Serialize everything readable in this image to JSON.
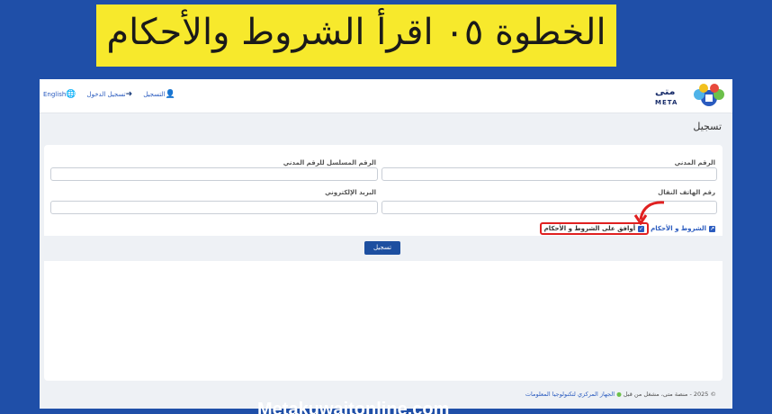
{
  "banner": {
    "text": "الخطوة ٠٥   اقرأ الشروط والأحكام"
  },
  "topbar": {
    "english": "English",
    "login": "تسجيل الدخول",
    "register": "التسجيل",
    "logo_text": "متى",
    "logo_sub": "META"
  },
  "page": {
    "title": "تسجيل"
  },
  "form": {
    "civil_id_label": "الرقم المدني",
    "serial_label": "الرقم المسلسل للرقم المدني",
    "mobile_label": "رقم الهاتف النقال",
    "email_label": "البريد الإلكتروني",
    "terms_link": "الشروط و الأحكام",
    "agree_label": "أوافق على الشروط و الأحكام",
    "submit_label": "تسجيل"
  },
  "footer": {
    "prefix": "© 2025 - منصة متى، مشغل من قبل",
    "org": "الجهاز المركزي لتكنولوجيا المعلومات"
  },
  "watermark": "Metakuwaitonline.com",
  "colors": {
    "accent": "#2a5bbf",
    "highlight": "#e02020",
    "banner": "#f7e92c",
    "background": "#1f4fa8"
  }
}
